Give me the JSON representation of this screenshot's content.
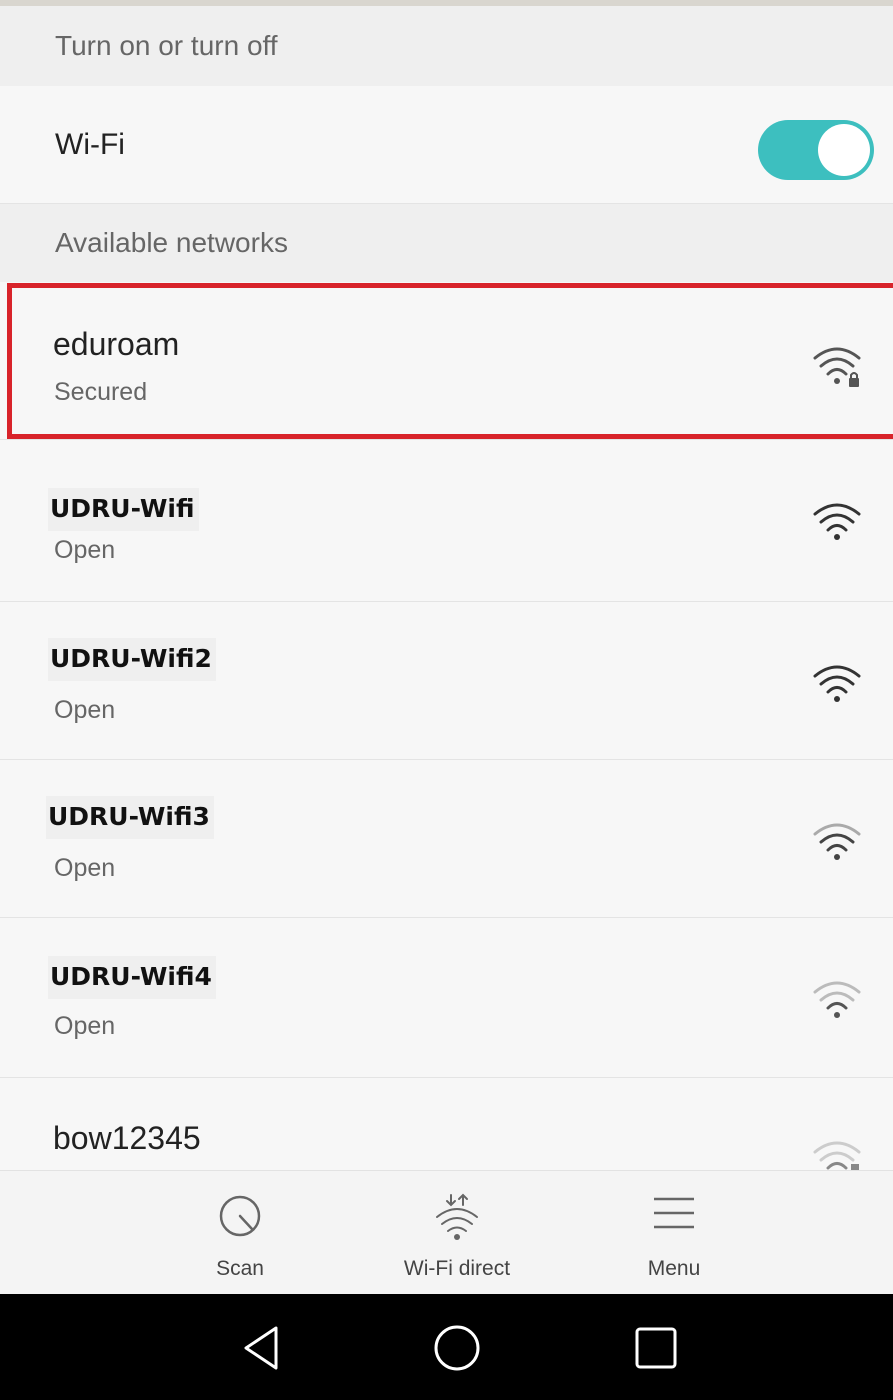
{
  "header": {
    "turn_label": "Turn on or turn off"
  },
  "wifi_toggle": {
    "label": "Wi-Fi",
    "state": "on",
    "color": "#3dbfbf"
  },
  "available": {
    "label": "Available networks"
  },
  "networks": [
    {
      "name": "eduroam",
      "status": "Secured",
      "icon": "wifi-lock-icon",
      "highlighted": true
    },
    {
      "name": "UDRU-Wifi",
      "status": "Open",
      "icon": "wifi-icon"
    },
    {
      "name": "UDRU-Wifi2",
      "status": "Open",
      "icon": "wifi-icon"
    },
    {
      "name": "UDRU-Wifi3",
      "status": "Open",
      "icon": "wifi-icon"
    },
    {
      "name": "UDRU-Wifi4",
      "status": "Open",
      "icon": "wifi-icon"
    },
    {
      "name": "bow12345",
      "status": "",
      "icon": "wifi-lock-icon"
    }
  ],
  "bottom_bar": {
    "scan": "Scan",
    "wifi_direct": "Wi-Fi direct",
    "menu": "Menu"
  },
  "highlight_color": "#d8232a",
  "navigation": {
    "back": "back-icon",
    "home": "home-icon",
    "recents": "recents-icon"
  }
}
